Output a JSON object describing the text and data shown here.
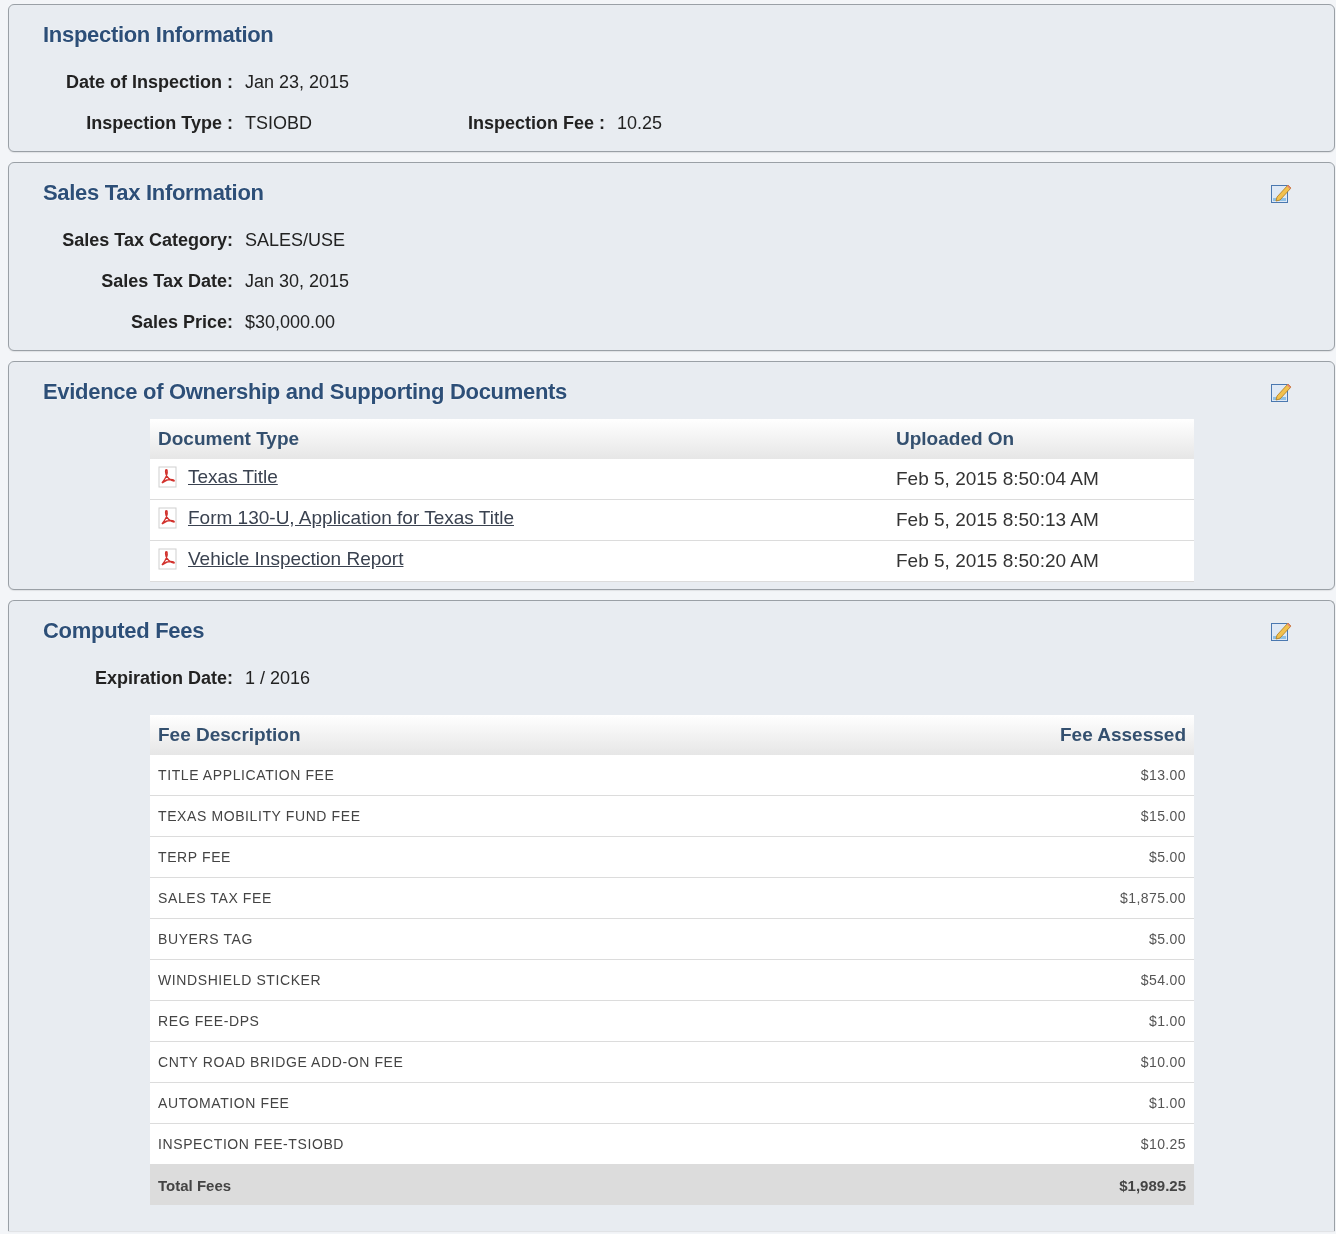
{
  "panels": [
    {
      "kind": "fields",
      "title": "Inspection Information",
      "editable": false,
      "rows": [
        [
          {
            "label": "Date of Inspection :",
            "value": "Jan 23, 2015"
          }
        ],
        [
          {
            "label": "Inspection Type :",
            "value": "TSIOBD"
          },
          {
            "label": "Inspection Fee :",
            "value": "10.25"
          }
        ]
      ]
    },
    {
      "kind": "fields",
      "title": "Sales Tax Information",
      "editable": true,
      "rows": [
        [
          {
            "label": "Sales Tax Category:",
            "value": "SALES/USE"
          }
        ],
        [
          {
            "label": "Sales Tax Date:",
            "value": "Jan 30, 2015"
          }
        ],
        [
          {
            "label": "Sales Price:",
            "value": "$30,000.00"
          }
        ]
      ]
    },
    {
      "kind": "documents",
      "title": "Evidence of Ownership and Supporting Documents",
      "editable": true,
      "columns": [
        "Document Type",
        "Uploaded On"
      ],
      "rows": [
        {
          "name": "Texas Title",
          "uploaded": "Feb 5, 2015 8:50:04 AM"
        },
        {
          "name": "Form 130-U, Application for Texas Title",
          "uploaded": "Feb 5, 2015 8:50:13 AM"
        },
        {
          "name": "Vehicle Inspection Report",
          "uploaded": "Feb 5, 2015 8:50:20 AM"
        }
      ]
    },
    {
      "kind": "fees",
      "title": "Computed Fees",
      "editable": true,
      "expiration": {
        "label": "Expiration Date:",
        "value": "1 / 2016"
      },
      "columns": [
        "Fee Description",
        "Fee Assessed"
      ],
      "rows": [
        {
          "description": "TITLE APPLICATION FEE",
          "amount": "$13.00"
        },
        {
          "description": "TEXAS MOBILITY FUND FEE",
          "amount": "$15.00"
        },
        {
          "description": "TERP FEE",
          "amount": "$5.00"
        },
        {
          "description": "SALES TAX FEE",
          "amount": "$1,875.00"
        },
        {
          "description": "BUYERS TAG",
          "amount": "$5.00"
        },
        {
          "description": "WINDSHIELD STICKER",
          "amount": "$54.00"
        },
        {
          "description": "REG FEE-DPS",
          "amount": "$1.00"
        },
        {
          "description": "CNTY ROAD BRIDGE ADD-ON FEE",
          "amount": "$10.00"
        },
        {
          "description": "AUTOMATION FEE",
          "amount": "$1.00"
        },
        {
          "description": "INSPECTION FEE-TSIOBD",
          "amount": "$10.25"
        }
      ],
      "total": {
        "label": "Total Fees",
        "amount": "$1,989.25"
      }
    }
  ]
}
